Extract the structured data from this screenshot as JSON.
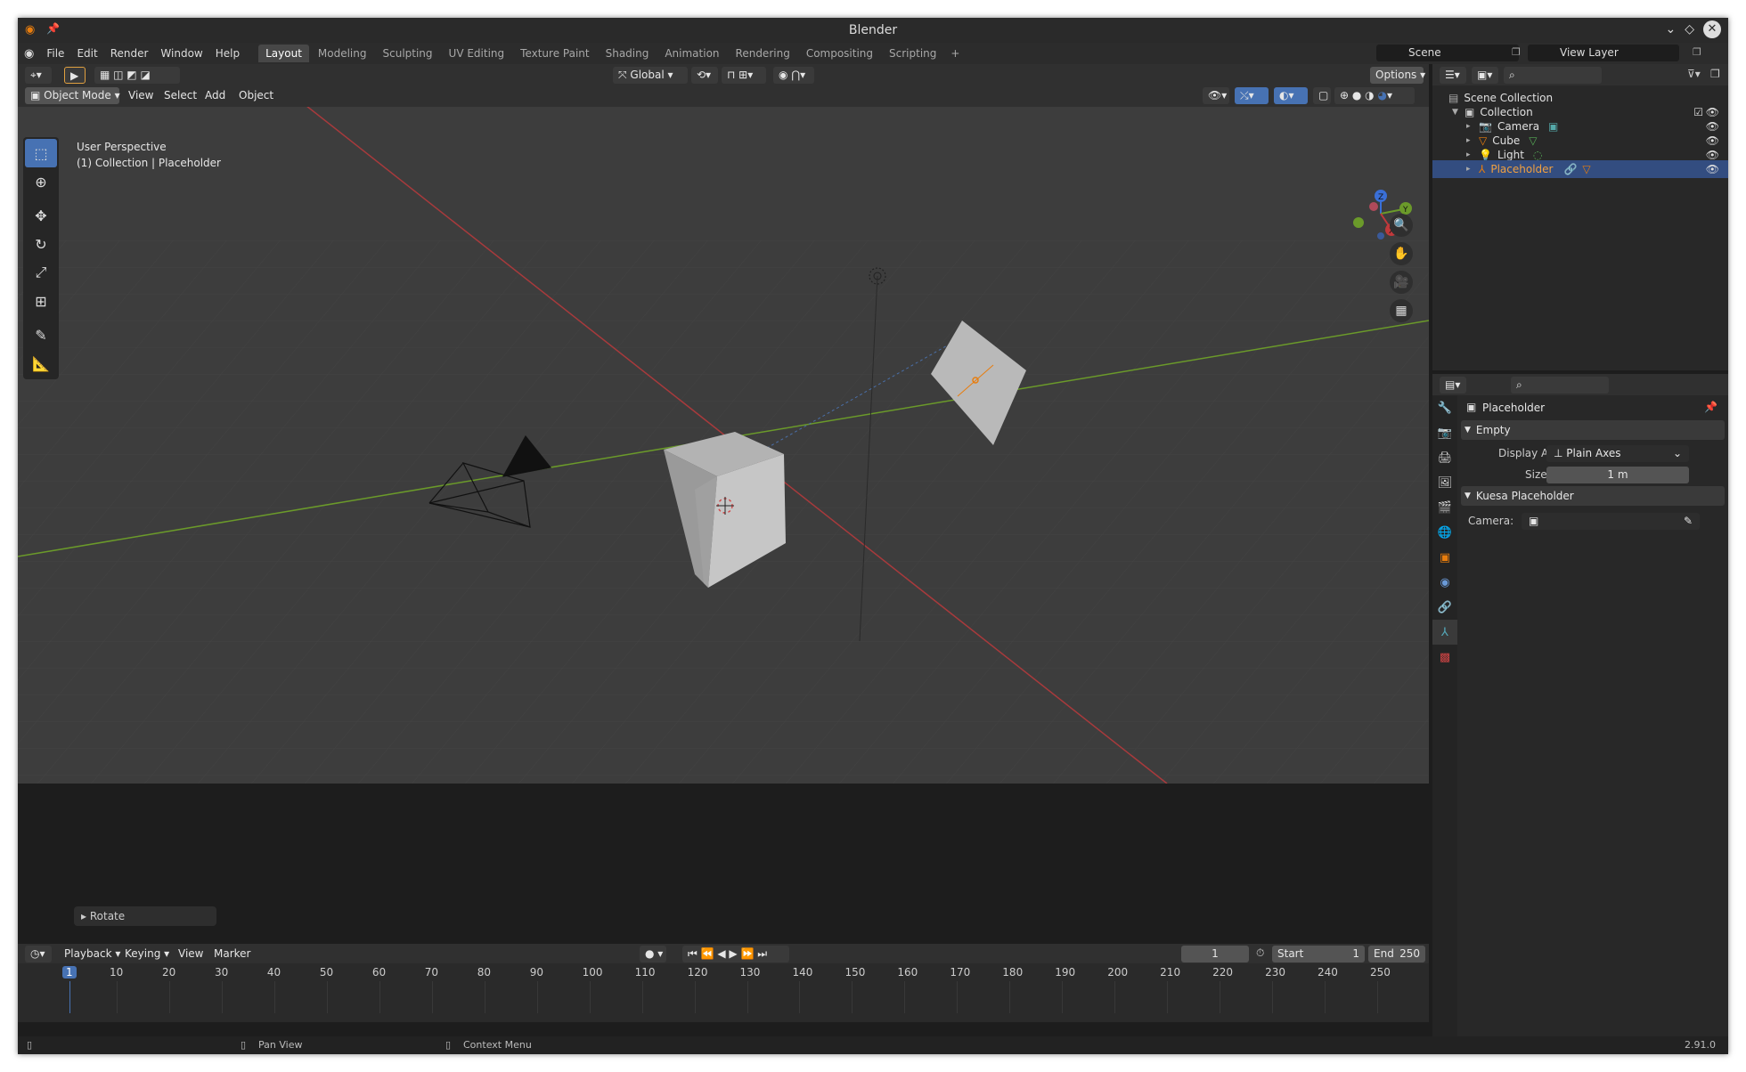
{
  "window": {
    "title": "Blender"
  },
  "menu": [
    "File",
    "Edit",
    "Render",
    "Window",
    "Help"
  ],
  "workspaces": [
    "Layout",
    "Modeling",
    "Sculpting",
    "UV Editing",
    "Texture Paint",
    "Shading",
    "Animation",
    "Rendering",
    "Compositing",
    "Scripting"
  ],
  "active_workspace": "Layout",
  "scene": {
    "name": "Scene",
    "view_layer": "View Layer"
  },
  "viewport": {
    "transform_orientation": "Global",
    "options_label": "Options",
    "mode": "Object Mode",
    "menus": [
      "View",
      "Select",
      "Add",
      "Object"
    ],
    "info_line1": "User Perspective",
    "info_line2": "(1) Collection | Placeholder",
    "operator_panel": "Rotate",
    "gizmo": {
      "z": "Z",
      "y": "Y",
      "x": "X"
    }
  },
  "outliner": {
    "scene_collection": "Scene Collection",
    "collection": "Collection",
    "objects": [
      "Camera",
      "Cube",
      "Light",
      "Placeholder"
    ],
    "selected": "Placeholder"
  },
  "properties": {
    "object_name": "Placeholder",
    "panel_empty": "Empty",
    "display_as_label": "Display As",
    "display_as_value": "Plain Axes",
    "size_label": "Size",
    "size_value": "1 m",
    "panel_kuesa": "Kuesa Placeholder",
    "camera_label": "Camera:"
  },
  "timeline": {
    "menus": [
      "Playback",
      "Keying",
      "View",
      "Marker"
    ],
    "current_frame": "1",
    "start_label": "Start",
    "start_value": "1",
    "end_label": "End",
    "end_value": "250",
    "ruler_ticks": [
      "1",
      "10",
      "20",
      "30",
      "40",
      "50",
      "60",
      "70",
      "80",
      "90",
      "100",
      "110",
      "120",
      "130",
      "140",
      "150",
      "160",
      "170",
      "180",
      "190",
      "200",
      "210",
      "220",
      "230",
      "240",
      "250"
    ]
  },
  "statusbar": {
    "pan": "Pan View",
    "context": "Context Menu",
    "version": "2.91.0"
  },
  "colors": {
    "accent": "#4772b3",
    "selected_row": "#334d80",
    "x_axis": "#c0393b",
    "y_axis": "#6b9a2a",
    "orange": "#e87d0d"
  }
}
